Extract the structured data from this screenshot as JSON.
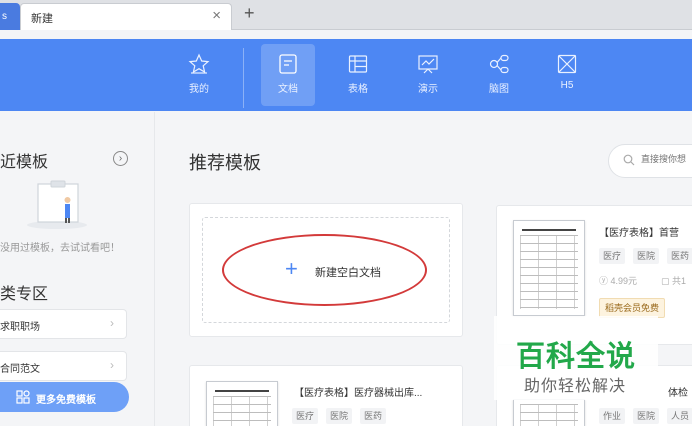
{
  "tabs": {
    "edge_label": "s",
    "active_title": "新建",
    "close_glyph": "×",
    "add_glyph": "+"
  },
  "nav": {
    "items": [
      {
        "label": "我的",
        "icon": "star-icon"
      },
      {
        "label": "文档",
        "icon": "document-icon",
        "active": true
      },
      {
        "label": "表格",
        "icon": "table-icon"
      },
      {
        "label": "演示",
        "icon": "presentation-icon"
      },
      {
        "label": "脑图",
        "icon": "mindmap-icon"
      },
      {
        "label": "H5",
        "icon": "h5-icon"
      }
    ],
    "band_color": "#4d87f3"
  },
  "sidebar": {
    "recent_title": "近模板",
    "empty_text": "没用过模板，去试试看吧！",
    "category_title": "类专区",
    "categories": [
      {
        "label": "求职职场"
      },
      {
        "label": "合同范文"
      }
    ],
    "free_button": "更多免费模板"
  },
  "main": {
    "title": "推荐模板",
    "search_placeholder": "直接搜你想",
    "blank_doc_label": "新建空白文档",
    "templates": [
      {
        "title": "【医疗表格】首营",
        "tags": [
          "医疗",
          "医院",
          "医药"
        ],
        "price": "4.99元",
        "pages": "共1",
        "member_badge": "稻壳会员免费"
      },
      {
        "title": "【医疗表格】医疗器械出库...",
        "tags": [
          "医疗",
          "医院",
          "医药"
        ]
      },
      {
        "title": "体检",
        "tags": [
          "作业",
          "医院",
          "人员"
        ]
      }
    ]
  },
  "watermark": {
    "main": "百科全说",
    "sub": "助你轻松解决",
    "color": "#22a84a"
  },
  "annotation_color": "#d33a3a"
}
